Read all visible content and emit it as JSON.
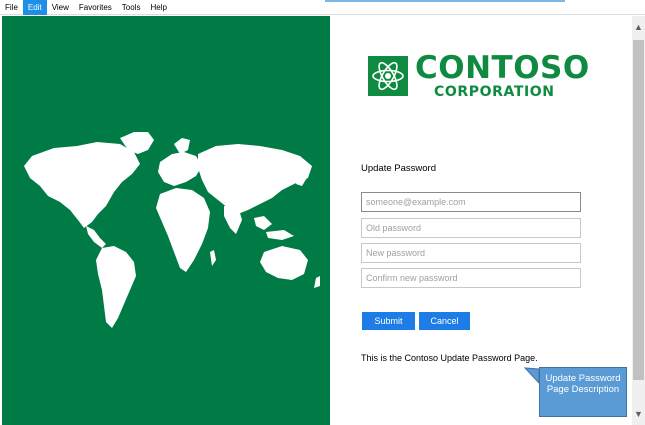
{
  "menu": {
    "items": [
      "File",
      "Edit",
      "View",
      "Favorites",
      "Tools",
      "Help"
    ],
    "active": "Edit"
  },
  "brand": {
    "name_line1": "CONTOSO",
    "name_line2": "CORPORATION",
    "color": "#0f8b41"
  },
  "panel": {
    "background": "#007b45"
  },
  "form": {
    "title": "Update Password",
    "fields": {
      "email_placeholder": "someone@example.com",
      "old_password_placeholder": "Old password",
      "new_password_placeholder": "New password",
      "confirm_password_placeholder": "Confirm new password"
    },
    "submit_label": "Submit",
    "cancel_label": "Cancel",
    "description": "This is the Contoso Update Password Page."
  },
  "callout": {
    "text": "Update Password Page Description"
  },
  "icons": {
    "logo": "atom-icon",
    "scroll_up": "chevron-up-icon",
    "scroll_down": "chevron-down-icon"
  },
  "colors": {
    "button": "#1e7ce6",
    "callout": "#5b9bd5"
  }
}
